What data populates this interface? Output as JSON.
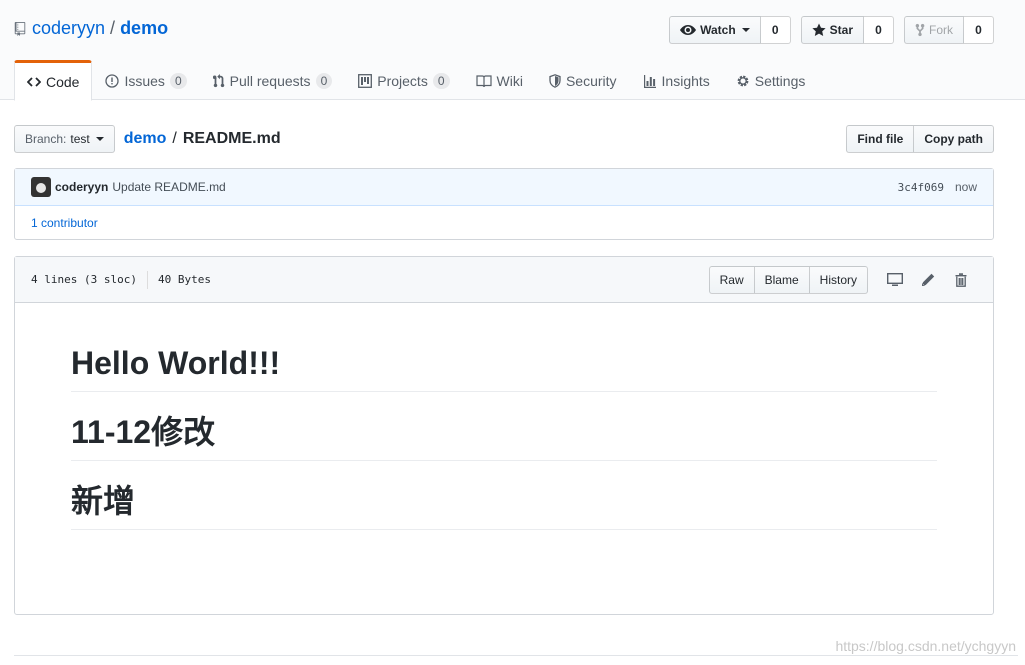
{
  "repo": {
    "owner": "coderyyn",
    "separator": "/",
    "name": "demo"
  },
  "actions": {
    "watch": {
      "label": "Watch",
      "count": "0"
    },
    "star": {
      "label": "Star",
      "count": "0"
    },
    "fork": {
      "label": "Fork",
      "count": "0"
    }
  },
  "tabs": [
    {
      "label": "Code",
      "counter": ""
    },
    {
      "label": "Issues",
      "counter": "0"
    },
    {
      "label": "Pull requests",
      "counter": "0"
    },
    {
      "label": "Projects",
      "counter": "0"
    },
    {
      "label": "Wiki",
      "counter": ""
    },
    {
      "label": "Security",
      "counter": ""
    },
    {
      "label": "Insights",
      "counter": ""
    },
    {
      "label": "Settings",
      "counter": ""
    }
  ],
  "file_nav": {
    "branch_prefix": "Branch:",
    "branch": "test",
    "breadcrumb_root": "demo",
    "breadcrumb_sep": "/",
    "file_name": "README.md",
    "find_file": "Find file",
    "copy_path": "Copy path"
  },
  "commit": {
    "author": "coderyyn",
    "message": "Update README.md",
    "sha": "3c4f069",
    "time": "now",
    "contributors": "1 contributor"
  },
  "file": {
    "lines": "4 lines (3 sloc)",
    "size": "40 Bytes",
    "raw": "Raw",
    "blame": "Blame",
    "history": "History"
  },
  "readme": {
    "headings": [
      "Hello World!!!",
      "11-12修改",
      "新增"
    ]
  },
  "watermark": "https://blog.csdn.net/ychgyyn",
  "colors": {
    "link": "#0366d6",
    "selected_tab_accent": "#e36209",
    "commit_bg": "#f1f8ff"
  }
}
